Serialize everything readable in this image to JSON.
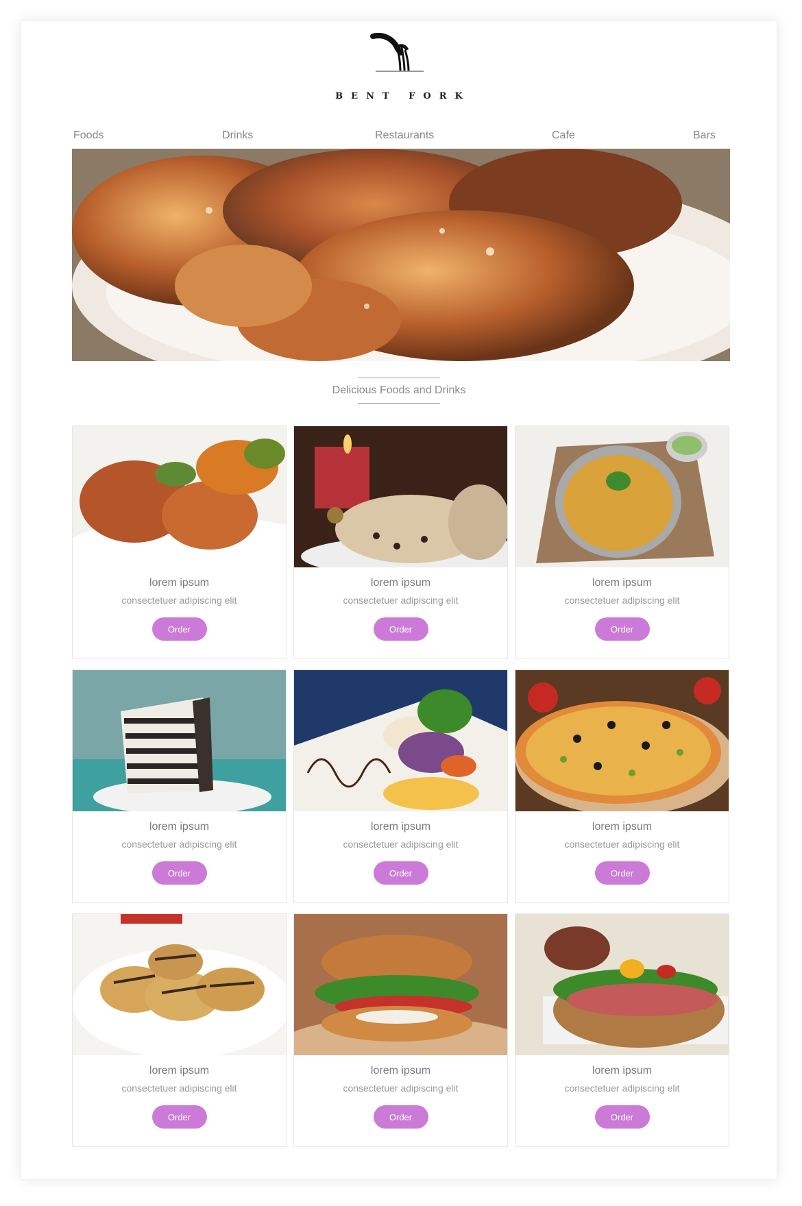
{
  "brand": {
    "name": "BENT FORK",
    "logo_icon": "bent-fork-icon"
  },
  "nav": {
    "items": [
      {
        "label": "Foods"
      },
      {
        "label": "Drinks"
      },
      {
        "label": "Restaurants"
      },
      {
        "label": "Cafe"
      },
      {
        "label": "Bars"
      }
    ]
  },
  "hero": {
    "image": "glazed-chicken-drumsticks-photo"
  },
  "section": {
    "title": "Delicious Foods and Drinks"
  },
  "products": [
    {
      "name": "lorem ipsum",
      "desc": "consectetuer adipiscing elit",
      "order_label": "Order",
      "image": "roast-chicken-vegetables-photo"
    },
    {
      "name": "lorem ipsum",
      "desc": "consectetuer adipiscing elit",
      "order_label": "Order",
      "image": "stollen-bread-candle-photo"
    },
    {
      "name": "lorem ipsum",
      "desc": "consectetuer adipiscing elit",
      "order_label": "Order",
      "image": "biryani-bowl-photo"
    },
    {
      "name": "lorem ipsum",
      "desc": "consectetuer adipiscing elit",
      "order_label": "Order",
      "image": "layered-cookie-cake-photo"
    },
    {
      "name": "lorem ipsum",
      "desc": "consectetuer adipiscing elit",
      "order_label": "Order",
      "image": "fish-salad-plate-photo"
    },
    {
      "name": "lorem ipsum",
      "desc": "consectetuer adipiscing elit",
      "order_label": "Order",
      "image": "pizza-photo"
    },
    {
      "name": "lorem ipsum",
      "desc": "consectetuer adipiscing elit",
      "order_label": "Order",
      "image": "grilled-chicken-photo"
    },
    {
      "name": "lorem ipsum",
      "desc": "consectetuer adipiscing elit",
      "order_label": "Order",
      "image": "sandwich-photo"
    },
    {
      "name": "lorem ipsum",
      "desc": "consectetuer adipiscing elit",
      "order_label": "Order",
      "image": "ham-sub-sandwich-photo"
    }
  ],
  "colors": {
    "accent": "#cc7ad8",
    "nav_text": "#888888",
    "border": "#e6e6e6"
  }
}
